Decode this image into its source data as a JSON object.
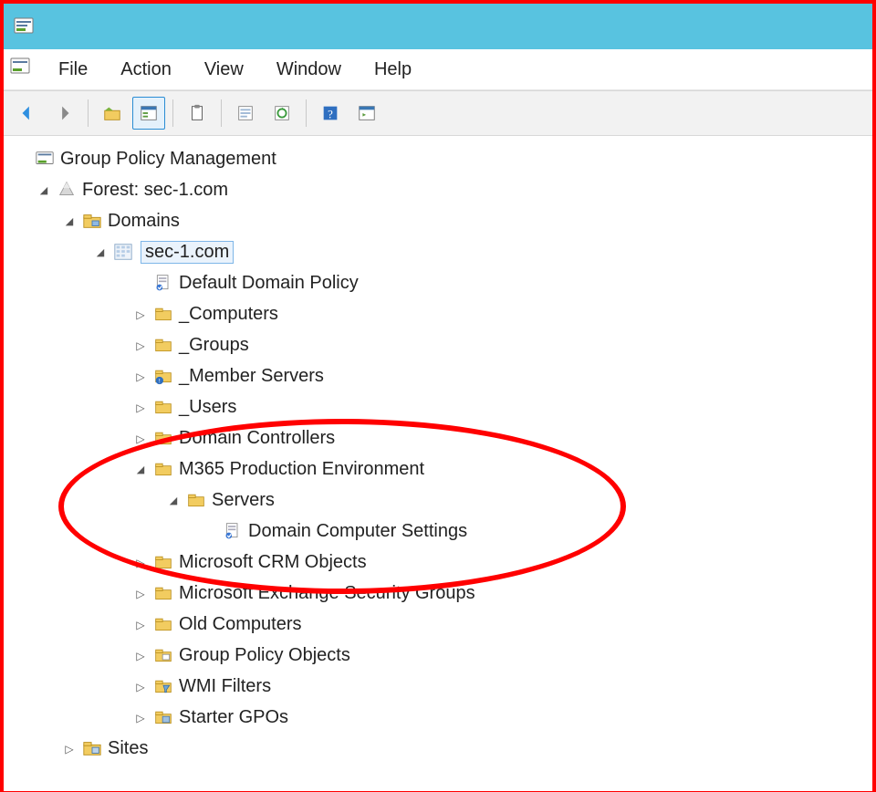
{
  "menubar": {
    "items": [
      "File",
      "Action",
      "View",
      "Window",
      "Help"
    ]
  },
  "tree": {
    "root": {
      "label": "Group Policy Management",
      "forest": {
        "label": "Forest: sec-1.com",
        "domains": {
          "label": "Domains",
          "domain": {
            "label": "sec-1.com",
            "children": [
              {
                "label": "Default Domain Policy",
                "type": "gpo"
              },
              {
                "label": "_Computers",
                "type": "ou",
                "expandable": true
              },
              {
                "label": "_Groups",
                "type": "ou",
                "expandable": true
              },
              {
                "label": "_Member Servers",
                "type": "ou",
                "expandable": true,
                "badge": true
              },
              {
                "label": "_Users",
                "type": "ou",
                "expandable": true
              },
              {
                "label": "Domain Controllers",
                "type": "ou",
                "expandable": true
              },
              {
                "label": "M365 Production Environment",
                "type": "ou",
                "expanded": true,
                "children": [
                  {
                    "label": "Servers",
                    "type": "ou",
                    "expanded": true,
                    "children": [
                      {
                        "label": "Domain Computer Settings",
                        "type": "gpo"
                      }
                    ]
                  }
                ]
              },
              {
                "label": "Microsoft CRM Objects",
                "type": "ou",
                "expandable": true
              },
              {
                "label": "Microsoft Exchange Security Groups",
                "type": "ou",
                "expandable": true
              },
              {
                "label": "Old Computers",
                "type": "ou",
                "expandable": true
              },
              {
                "label": "Group Policy Objects",
                "type": "container",
                "expandable": true
              },
              {
                "label": "WMI Filters",
                "type": "container",
                "expandable": true
              },
              {
                "label": "Starter GPOs",
                "type": "container",
                "expandable": true
              }
            ]
          }
        },
        "sites": {
          "label": "Sites"
        }
      }
    }
  }
}
